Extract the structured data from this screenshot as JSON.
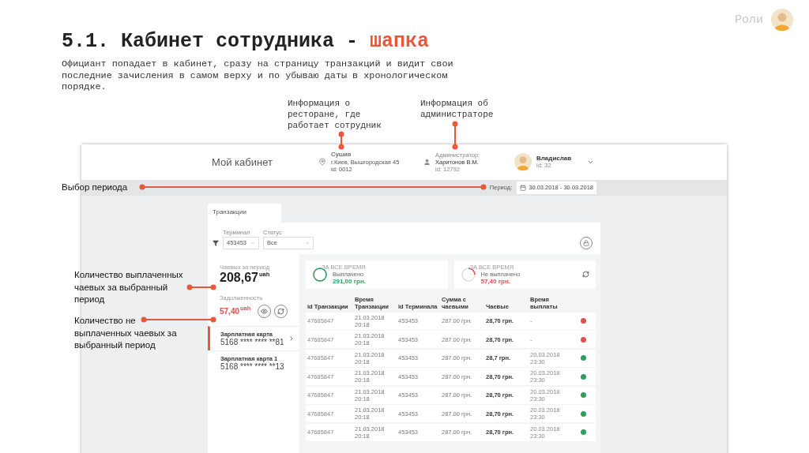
{
  "slide": {
    "roles_label": "Роли",
    "title": "5.1. Кабинет сотрудника - ",
    "title_accent": "шапка",
    "description": "Официант попадает в кабинет, сразу на страницу транзакций и видит свои последние зачисления в самом верху и по убываю даты в хронологическом порядке."
  },
  "annotations": {
    "restaurant": "Информация о ресторане, где работает сотрудник",
    "admin": "Информация об администраторе",
    "period": "Выбор периода",
    "paid": "Количество выплаченных чаевых за выбранный период",
    "unpaid": "Количество не выплаченных чаевых за выбранный период"
  },
  "header": {
    "title": "Мой кабинет",
    "restaurant": {
      "name": "Сушия",
      "address": "г.Киев, Вышгородская 45",
      "id": "id: 0012"
    },
    "admin": {
      "label": "Администратор:",
      "name": "Харитонов В.М.",
      "id": "id: 12792"
    },
    "user": {
      "name": "Владислав",
      "id": "id: 32"
    }
  },
  "period": {
    "label": "Период:",
    "value": "30.03.2018 - 30.03.2018"
  },
  "tabs": [
    {
      "label": "Транзакции",
      "selected": true
    }
  ],
  "filters": [
    {
      "label": "Терминал",
      "value": "453453"
    },
    {
      "label": "Статус",
      "value": "Все"
    }
  ],
  "tips": {
    "label": "Чаевых за период",
    "amount": "208,67",
    "unit": "uah",
    "debt_label": "Задолженность",
    "debt": "57,40",
    "debt_unit": "uah"
  },
  "cards": [
    {
      "name": "Зарплатная карта",
      "number": "5168 **** **** **81",
      "selected": true
    },
    {
      "name": "Зарплатная карта 1",
      "number": "5168 **** **** **13",
      "selected": false
    }
  ],
  "summary": [
    {
      "caption": "ЗА ВСЕ ВРЕМЯ",
      "label": "Выплачено",
      "amount": "291,00 грн.",
      "kind": "paid"
    },
    {
      "caption": "ЗА ВСЕ ВРЕМЯ",
      "label": "Не выплачено",
      "amount": "57,40 грн.",
      "kind": "unpaid"
    }
  ],
  "table": {
    "columns": [
      "id Транзакции",
      "Время Транзакции",
      "id Терминала",
      "Сумма с чаевыми",
      "Чаевые",
      "Время выплаты"
    ],
    "rows": [
      {
        "id": "47685847",
        "time": "21.03.2018 20:18",
        "terminal": "453453",
        "sum": "287.00 грн.",
        "tips": "28,70 грн.",
        "paid_at": "-",
        "paid": false
      },
      {
        "id": "47685847",
        "time": "21.03.2018 20:18",
        "terminal": "453453",
        "sum": "287.00 грн.",
        "tips": "28,70 грн.",
        "paid_at": "-",
        "paid": false
      },
      {
        "id": "47685847",
        "time": "21.03.2018 20:18",
        "terminal": "453453",
        "sum": "287.00 грн.",
        "tips": "28,7 грн.",
        "paid_at": "20.03.2018 23:30",
        "paid": true
      },
      {
        "id": "47685847",
        "time": "21.03.2018 20:18",
        "terminal": "453453",
        "sum": "287.00 грн.",
        "tips": "28,70 грн.",
        "paid_at": "20.03.2018 23:30",
        "paid": true
      },
      {
        "id": "47685847",
        "time": "21.03.2018 20:18",
        "terminal": "453453",
        "sum": "287.00 грн.",
        "tips": "28,70 грн.",
        "paid_at": "20.03.2018 23:30",
        "paid": true
      },
      {
        "id": "47685847",
        "time": "21.03.2018 20:18",
        "terminal": "453453",
        "sum": "287.00 грн.",
        "tips": "28,70 грн.",
        "paid_at": "20.03.2018 23:30",
        "paid": true
      },
      {
        "id": "47685847",
        "time": "21.03.2018 20:18",
        "terminal": "453453",
        "sum": "287.00 грн.",
        "tips": "28,70 грн.",
        "paid_at": "20.03.2018 23:30",
        "paid": true
      }
    ]
  }
}
